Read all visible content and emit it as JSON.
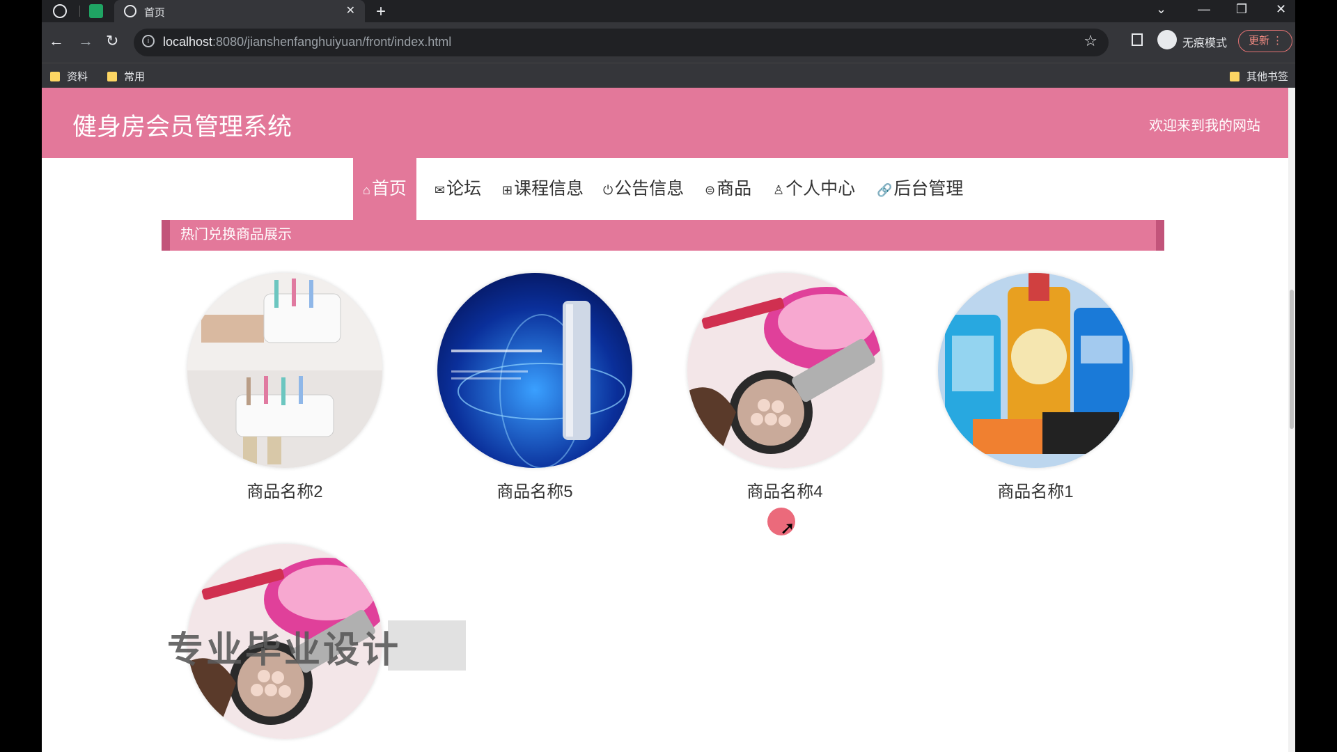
{
  "browser": {
    "tab_title": "首页",
    "url_host": "localhost",
    "url_path": ":8080/jianshenfanghuiyuan/front/index.html",
    "incognito_label": "无痕模式",
    "update_label": "更新",
    "bookmarks": [
      "资料",
      "常用"
    ],
    "other_bookmarks": "其他书签"
  },
  "site": {
    "title": "健身房会员管理系统",
    "welcome": "欢迎来到我的网站"
  },
  "nav": [
    {
      "label": "首页",
      "icon": "home-icon",
      "active": true
    },
    {
      "label": "论坛",
      "icon": "mail-icon",
      "active": false
    },
    {
      "label": "课程信息",
      "icon": "grid-icon",
      "active": false
    },
    {
      "label": "公告信息",
      "icon": "power-icon",
      "active": false
    },
    {
      "label": "商品",
      "icon": "circle-icon",
      "active": false
    },
    {
      "label": "个人中心",
      "icon": "user-icon",
      "active": false
    },
    {
      "label": "后台管理",
      "icon": "link-icon",
      "active": false
    }
  ],
  "section": {
    "title": "热门兑换商品展示"
  },
  "products": [
    {
      "name": "商品名称2",
      "image": "toothbrush-holder"
    },
    {
      "name": "商品名称5",
      "image": "skincare-bottle"
    },
    {
      "name": "商品名称4",
      "image": "makeup-cosmetics"
    },
    {
      "name": "商品名称1",
      "image": "detergent-products"
    },
    {
      "name": "",
      "image": "makeup-cosmetics"
    }
  ],
  "watermark": "专业毕业设计",
  "colors": {
    "accent": "#e3789a",
    "accent_dark": "#c2547a"
  }
}
